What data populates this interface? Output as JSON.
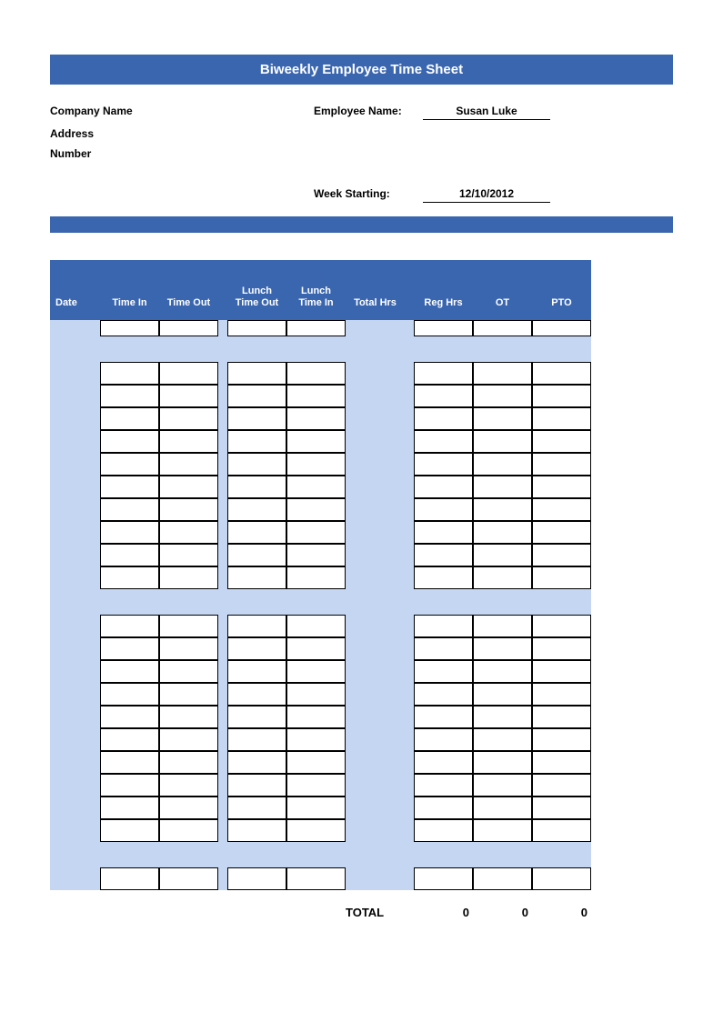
{
  "title": "Biweekly Employee Time Sheet",
  "info": {
    "company_label": "Company Name",
    "address_label": "Address",
    "number_label": "Number",
    "employee_label": "Employee Name:",
    "employee_name": "Susan Luke",
    "week_label": "Week Starting:",
    "week_start": "12/10/2012"
  },
  "headers": {
    "date": "Date",
    "time_in": "Time In",
    "time_out": "Time Out",
    "lunch_out": "Lunch Time Out",
    "lunch_in": "Lunch Time In",
    "total_hrs": "Total Hrs",
    "reg_hrs": "Reg Hrs",
    "ot": "OT",
    "pto": "PTO"
  },
  "totals": {
    "label": "TOTAL",
    "reg": "0",
    "ot": "0",
    "pto": "0"
  }
}
